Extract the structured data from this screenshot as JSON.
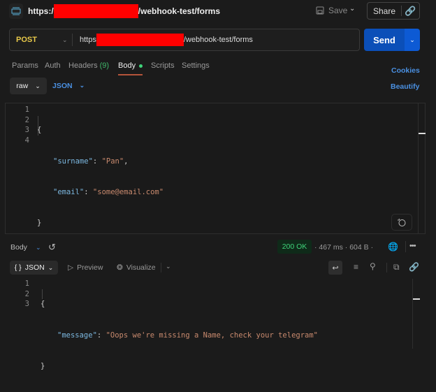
{
  "header": {
    "url_prefix": "https:/",
    "url_suffix": "/webhook-test/forms",
    "save_label": "Save",
    "share_label": "Share"
  },
  "request": {
    "method": "POST",
    "url_prefix": "https",
    "url_suffix": "/webhook-test/forms",
    "send_label": "Send"
  },
  "tabs": [
    {
      "label": "Params"
    },
    {
      "label": "Auth"
    },
    {
      "label": "Headers",
      "count": "(9)"
    },
    {
      "label": "Body"
    },
    {
      "label": "Scripts"
    },
    {
      "label": "Settings"
    }
  ],
  "cookies_label": "Cookies",
  "body_mode": "raw",
  "body_format": "JSON",
  "beautify_label": "Beautify",
  "request_body": {
    "line_numbers": [
      "1",
      "2",
      "3",
      "4"
    ],
    "open": "{",
    "close": "}",
    "lines": [
      {
        "key": "\"surname\"",
        "value": "\"Pan\"",
        "trail": ","
      },
      {
        "key": "\"email\"",
        "value": "\"some@email.com\"",
        "trail": ""
      }
    ]
  },
  "response": {
    "section_label": "Body",
    "status": "200 OK",
    "time": "467 ms",
    "size": "604 B",
    "format": "JSON",
    "preview_label": "Preview",
    "visualize_label": "Visualize",
    "line_numbers": [
      "1",
      "2",
      "3"
    ],
    "open": "{",
    "close": "}",
    "key": "\"message\"",
    "value": "\"Oops we're missing a Name, check your telegram\""
  },
  "colors": {
    "accent": "#0b5cd5",
    "status_ok": "#3fd47a",
    "method": "#e8c94a",
    "link": "#4a90e2"
  }
}
